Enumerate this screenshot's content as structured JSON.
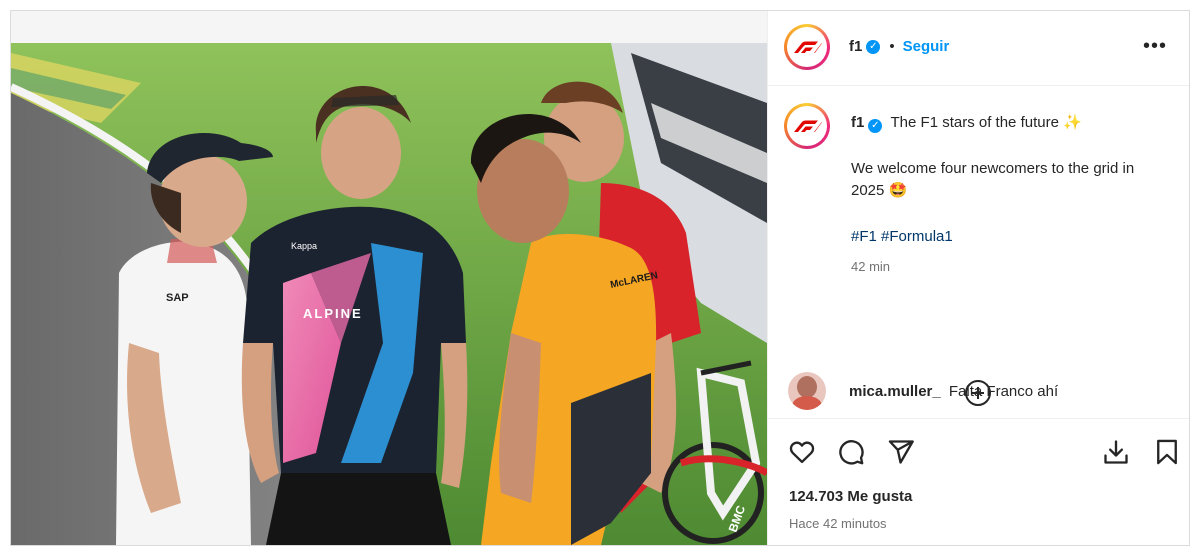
{
  "account": {
    "username": "f1",
    "verified_mark": "✓",
    "follow_label": "Seguir",
    "separator": "•",
    "more_label": "•••"
  },
  "caption": {
    "username": "f1",
    "line1": "The F1 stars of the future",
    "line1_emoji": "✨",
    "paragraph": "We welcome four newcomers to the grid in 2025",
    "paragraph_emoji": "🤩",
    "hashtags": [
      "#F1",
      "#Formula1"
    ],
    "time": "42 min"
  },
  "comment": {
    "username": "mica.muller_",
    "text": "Falta Franco ahí"
  },
  "actions": {
    "icons": [
      "heart-icon",
      "comment-icon",
      "share-icon",
      "download-icon",
      "bookmark-icon"
    ]
  },
  "stats": {
    "likes": "124.703 Me gusta",
    "posted": "Hace 42 minutos"
  },
  "photo": {
    "jersey_text": "ALPINE",
    "jersey_brand": "Kappa",
    "shirt_text_white": "SAP",
    "shirt_text_mclaren": "McLAREN",
    "bike_brand": "BMC"
  },
  "colors": {
    "accent_blue": "#0095f6",
    "f1_red": "#e10600",
    "hashtag": "#00376b"
  }
}
